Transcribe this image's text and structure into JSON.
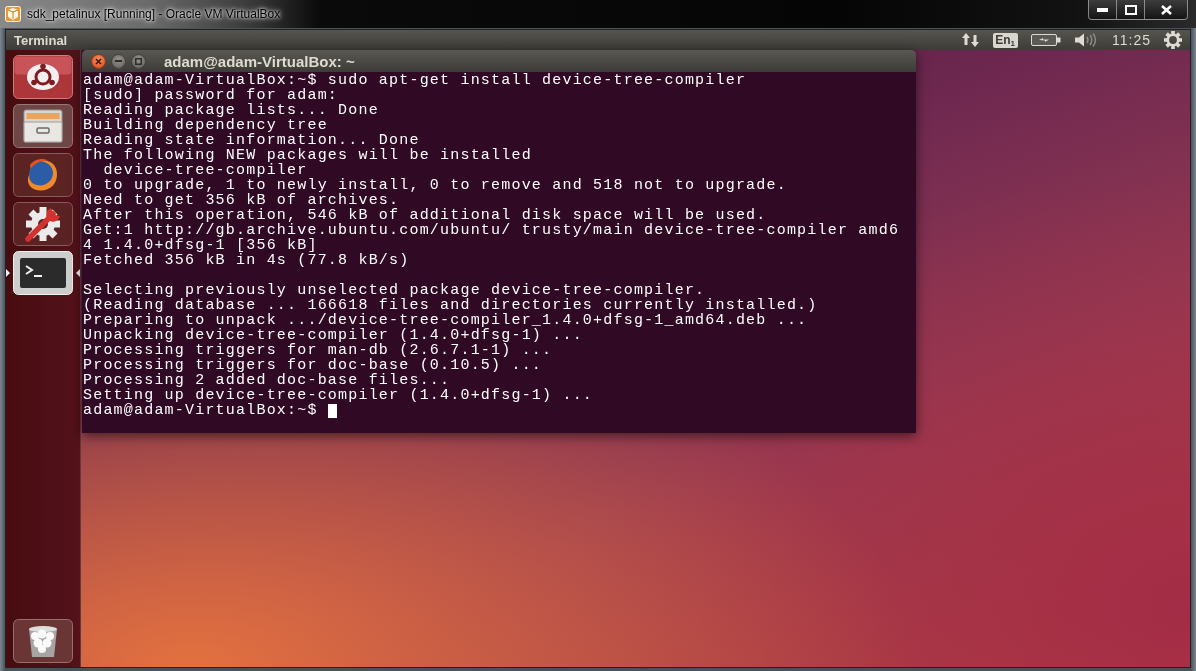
{
  "window": {
    "title": "sdk_petalinux [Running] - Oracle VM VirtualBox",
    "controls": [
      {
        "kind": "minimize"
      },
      {
        "kind": "maximize"
      },
      {
        "kind": "close"
      }
    ]
  },
  "top_panel": {
    "app_name": "Terminal",
    "indicators": [
      {
        "kind": "network"
      },
      {
        "kind": "keyboard",
        "label": "En$_{1}$"
      },
      {
        "kind": "battery"
      },
      {
        "kind": "volume"
      },
      {
        "kind": "clock",
        "label": "11:25"
      },
      {
        "kind": "session"
      }
    ]
  },
  "launcher": {
    "items": [
      {
        "kind": "home",
        "running": false,
        "focused": false
      },
      {
        "kind": "files",
        "running": false,
        "focused": false
      },
      {
        "kind": "browser",
        "running": false,
        "focused": false
      },
      {
        "kind": "settings",
        "running": false,
        "focused": false
      },
      {
        "kind": "terminal",
        "running": true,
        "focused": true
      },
      {
        "kind": "trash",
        "running": false,
        "focused": false
      }
    ]
  },
  "terminal_window": {
    "title": "adam@adam-VirtualBox: ~",
    "buttons": [
      {
        "kind": "close"
      },
      {
        "kind": "minimize"
      },
      {
        "kind": "maximize"
      }
    ],
    "output_blocks": [
      {
        "lines": [
          "adam@adam-VirtualBox:~$ sudo apt-get install device-tree-compiler",
          "[sudo] password for adam:",
          "Reading package lists... Done",
          "Building dependency tree",
          "Reading state information... Done",
          "The following NEW packages will be installed",
          "  device-tree-compiler",
          "0 to upgrade, 1 to newly install, 0 to remove and 518 not to upgrade.",
          "Need to get 356 kB of archives.",
          "After this operation, 546 kB of additional disk space will be used.",
          "Get:1 http://gb.archive.ubuntu.com/ubuntu/ trusty/main device-tree-compiler amd6",
          "4 1.4.0+dfsg-1 [356 kB]",
          "Fetched 356 kB in 4s (77.8 kB/s)"
        ]
      },
      {
        "lines": [
          "Selecting previously unselected package device-tree-compiler.",
          "(Reading database ... 166618 files and directories currently installed.)",
          "Preparing to unpack .../device-tree-compiler_1.4.0+dfsg-1_amd64.deb ...",
          "Unpacking device-tree-compiler (1.4.0+dfsg-1) ...",
          "Processing triggers for man-db (2.6.7.1-1) ...",
          "Processing triggers for doc-base (0.10.5) ...",
          "Processing 2 added doc-base files...",
          "Setting up device-tree-compiler (1.4.0+dfsg-1) ..."
        ]
      }
    ],
    "prompt": {
      "text": "adam@adam-VirtualBox:~$",
      "cursor": true
    }
  }
}
